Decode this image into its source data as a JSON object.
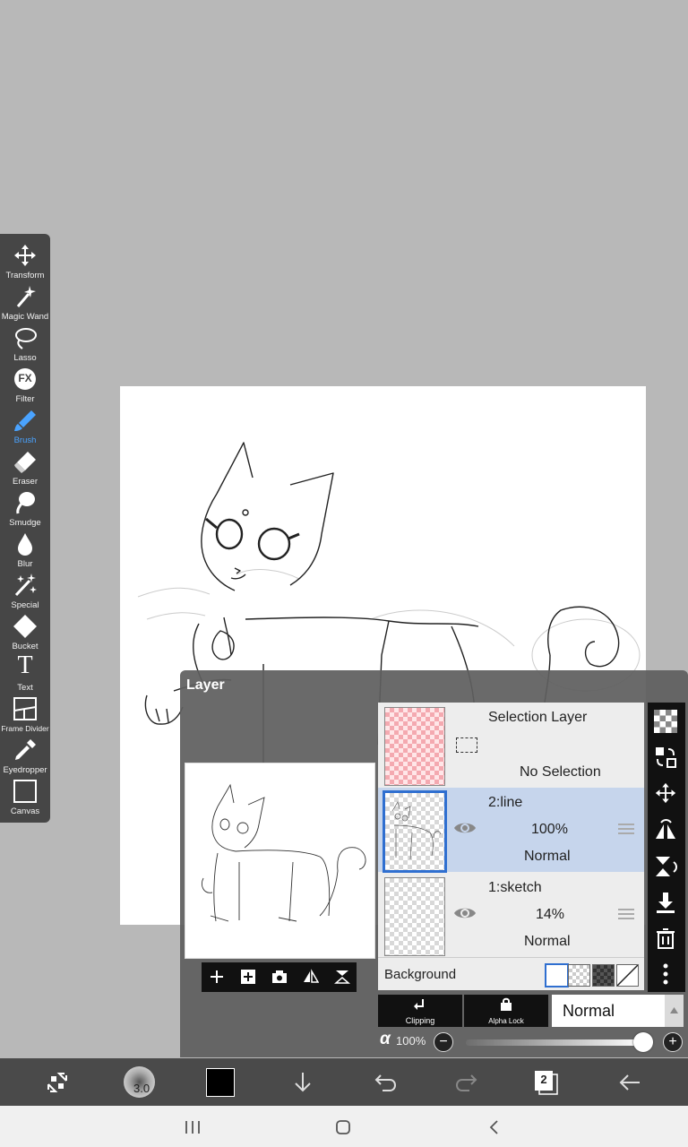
{
  "toolbar": {
    "items": [
      {
        "label": "Transform",
        "icon": "move-arrows-icon"
      },
      {
        "label": "Magic Wand",
        "icon": "magic-wand-icon"
      },
      {
        "label": "Lasso",
        "icon": "lasso-icon"
      },
      {
        "label": "Filter",
        "icon": "fx-icon",
        "glyph": "FX"
      },
      {
        "label": "Brush",
        "icon": "brush-icon",
        "active": true
      },
      {
        "label": "Eraser",
        "icon": "eraser-icon"
      },
      {
        "label": "Smudge",
        "icon": "smudge-icon"
      },
      {
        "label": "Blur",
        "icon": "blur-drop-icon"
      },
      {
        "label": "Special",
        "icon": "special-wand-icon"
      },
      {
        "label": "Bucket",
        "icon": "bucket-icon"
      },
      {
        "label": "Text",
        "icon": "text-icon",
        "glyph": "T"
      },
      {
        "label": "Frame Divider",
        "icon": "frame-divider-icon"
      },
      {
        "label": "Eyedropper",
        "icon": "eyedropper-icon"
      },
      {
        "label": "Canvas",
        "icon": "canvas-icon"
      }
    ],
    "active_color": "#4aa3ff"
  },
  "layer_panel": {
    "title": "Layer",
    "layers": [
      {
        "name": "Selection Layer",
        "status": "No Selection",
        "type": "selection"
      },
      {
        "name": "2:line",
        "opacity": "100%",
        "blend": "Normal",
        "selected": true
      },
      {
        "name": "1:sketch",
        "opacity": "14%",
        "blend": "Normal",
        "selected": false
      }
    ],
    "background_label": "Background",
    "clipping_label": "Clipping",
    "alpha_lock_label": "Alpha Lock",
    "blend_mode": "Normal",
    "alpha_symbol": "α",
    "alpha_value": "100%",
    "alpha_fraction": 1.0,
    "minus": "−",
    "plus": "+"
  },
  "bottom_bar": {
    "brush_size": "3.0",
    "current_color": "#000000",
    "layer_count": "2"
  }
}
